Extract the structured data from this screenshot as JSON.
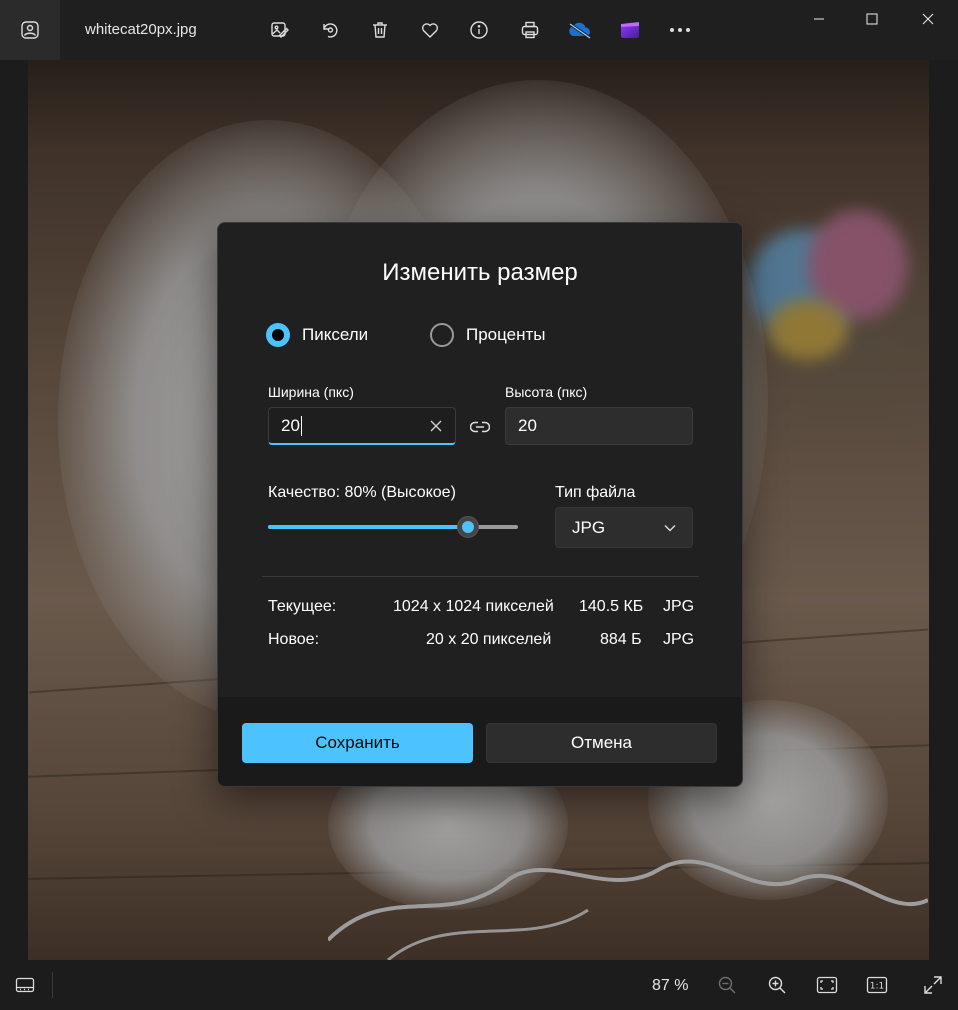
{
  "titlebar": {
    "file_name": "whitecat20px.jpg",
    "toolbar_icons": [
      "edit-image-icon",
      "rotate-icon",
      "delete-icon",
      "favorite-icon",
      "info-icon",
      "print-icon",
      "onedrive-icon",
      "clipchamp-icon",
      "more-icon"
    ],
    "window_controls": [
      "minimize-icon",
      "maximize-icon",
      "close-icon"
    ]
  },
  "dialog": {
    "title": "Изменить размер",
    "unit_options": [
      {
        "label": "Пиксели",
        "selected": true
      },
      {
        "label": "Проценты",
        "selected": false
      }
    ],
    "width": {
      "label": "Ширина (пкс)",
      "value": "20"
    },
    "height": {
      "label": "Высота (пкс)",
      "value": "20"
    },
    "quality": {
      "label": "Качество: 80% (Высокое)",
      "value_percent": 80
    },
    "file_type": {
      "label": "Тип файла",
      "selected": "JPG"
    },
    "current": {
      "label": "Текущее:",
      "dimensions": "1024 x 1024 пикселей",
      "size": "140.5 КБ",
      "format": "JPG"
    },
    "new": {
      "label": "Новое:",
      "dimensions": "20 x 20 пикселей",
      "size": "884 Б",
      "format": "JPG"
    },
    "save_label": "Сохранить",
    "cancel_label": "Отмена"
  },
  "bottombar": {
    "zoom": "87 %"
  },
  "colors": {
    "accent": "#4cc2ff",
    "dialog_bg": "#202020",
    "footer_bg": "#1a1a1a"
  }
}
